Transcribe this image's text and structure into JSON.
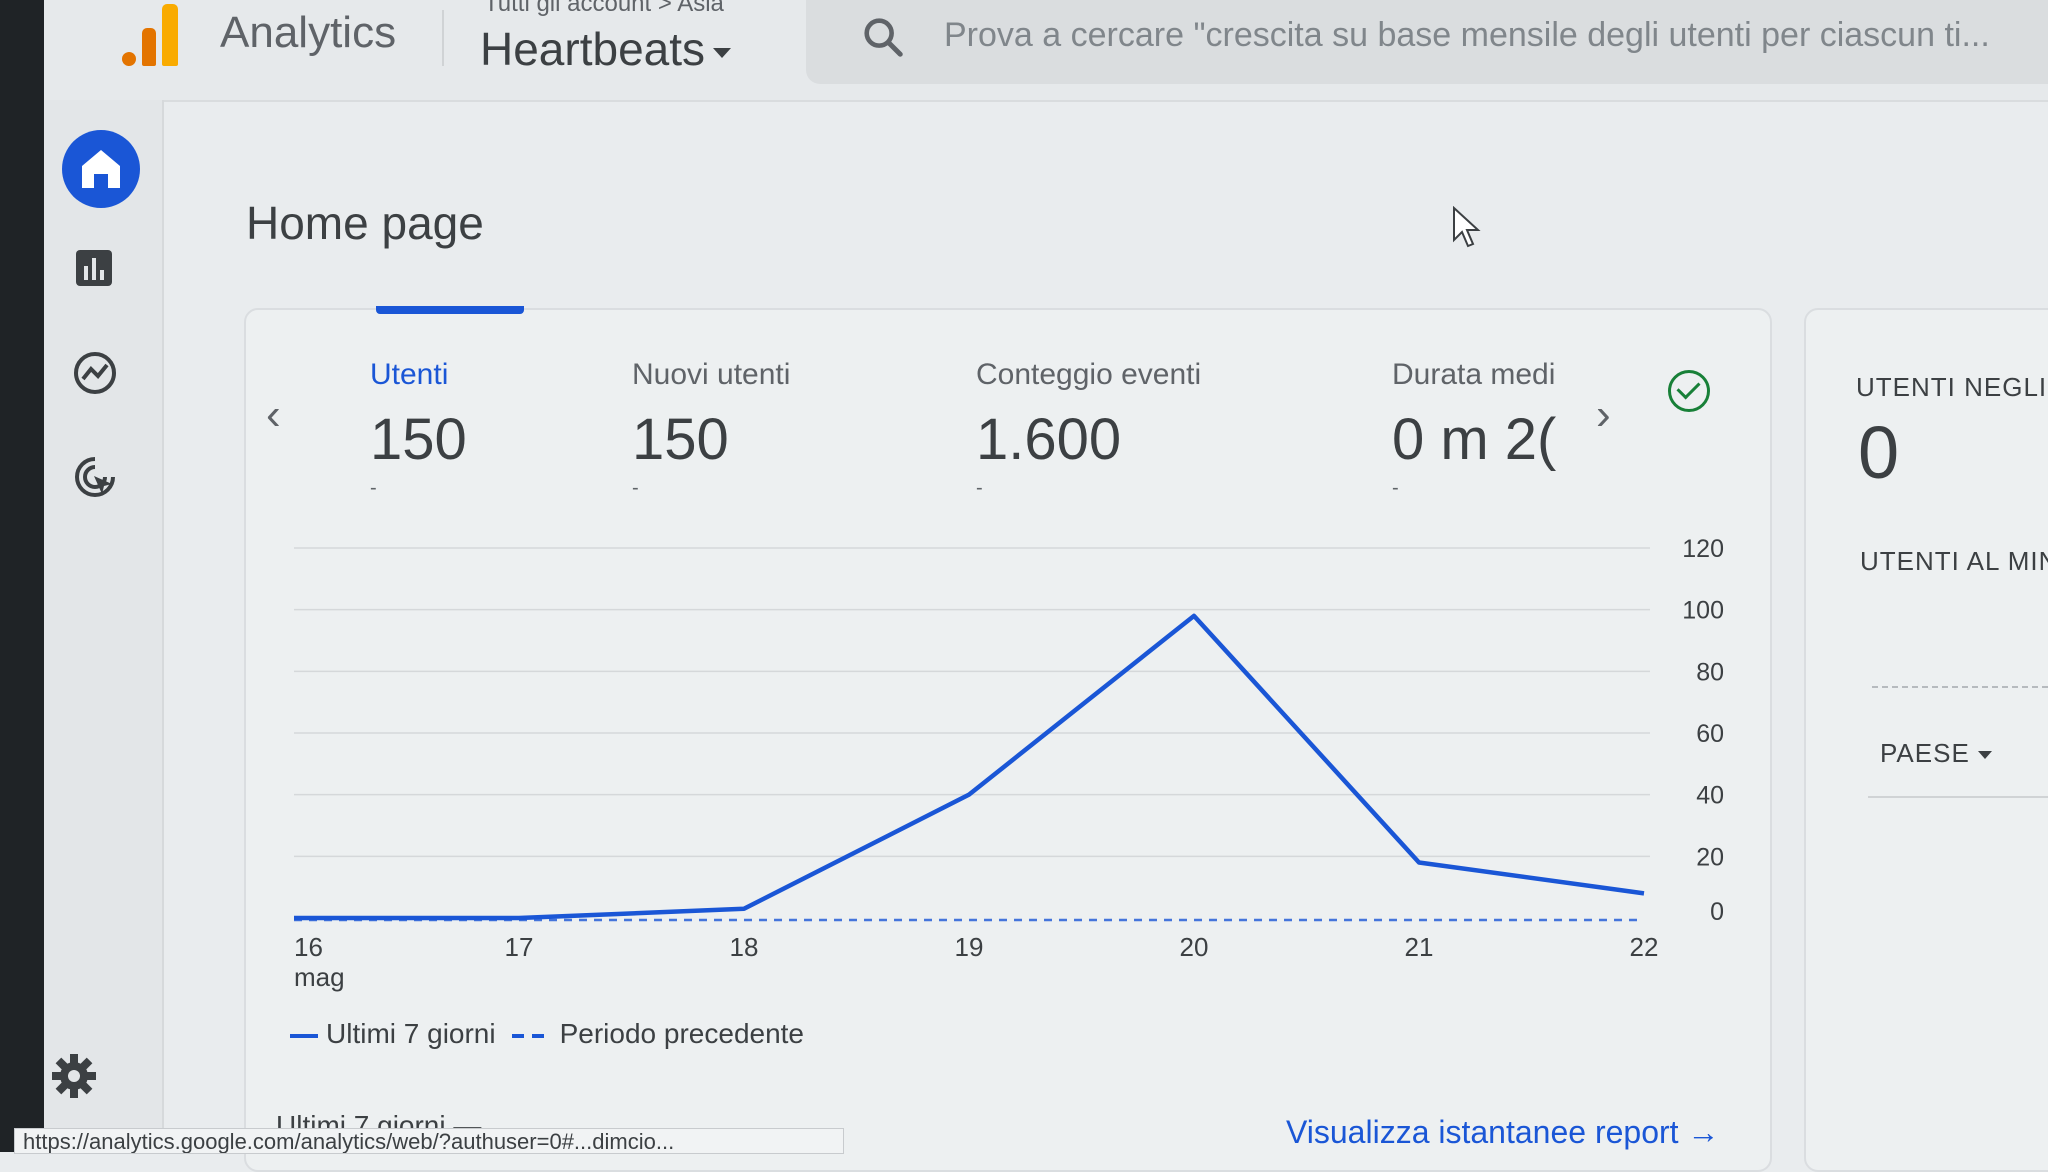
{
  "header": {
    "app_name": "Analytics",
    "breadcrumb": "Tutti gli account > Asia",
    "property": "Heartbeats",
    "search_placeholder": "Prova a cercare \"crescita su base mensile degli utenti per ciascun ti..."
  },
  "page": {
    "title": "Home page"
  },
  "metrics": [
    {
      "label": "Utenti",
      "value": "150",
      "delta": "-"
    },
    {
      "label": "Nuovi utenti",
      "value": "150",
      "delta": "-"
    },
    {
      "label": "Conteggio eventi",
      "value": "1.600",
      "delta": "-"
    },
    {
      "label": "Durata medi",
      "value": "0 m 2(",
      "delta": "-"
    }
  ],
  "realtime": {
    "users_label": "UTENTI NEGLI U",
    "users_value": "0",
    "per_minute_label": "UTENTI AL MIN",
    "country_dropdown": "PAESE"
  },
  "chart_data": {
    "type": "line",
    "x": [
      "16\nmag",
      "17",
      "18",
      "19",
      "20",
      "21",
      "22"
    ],
    "series": [
      {
        "name": "Ultimi 7 giorni",
        "values": [
          0,
          0,
          3,
          40,
          98,
          18,
          8
        ]
      },
      {
        "name": "Periodo precedente",
        "values": [
          0,
          0,
          0,
          0,
          0,
          0,
          0
        ]
      }
    ],
    "yticks": [
      0,
      20,
      40,
      60,
      80,
      100,
      120
    ],
    "ylim": [
      0,
      120
    ],
    "legend_position": "bottom-left",
    "grid": true,
    "colors": {
      "current": "#1a56d6",
      "previous": "#1a56d6"
    }
  },
  "footer": {
    "period_label": "Ultimi 7 giorni —",
    "report_link": "Visualizza istantanee report",
    "status_url": "https://analytics.google.com/analytics/web/?authuser=0#...dimcio..."
  },
  "icons": {
    "home": "home-icon",
    "reports": "bar-chart-icon",
    "explore": "explore-icon",
    "advertising": "advertising-icon",
    "settings": "gear-icon",
    "search": "search-icon"
  },
  "colors": {
    "accent": "#1a56d6",
    "check": "#188038"
  }
}
